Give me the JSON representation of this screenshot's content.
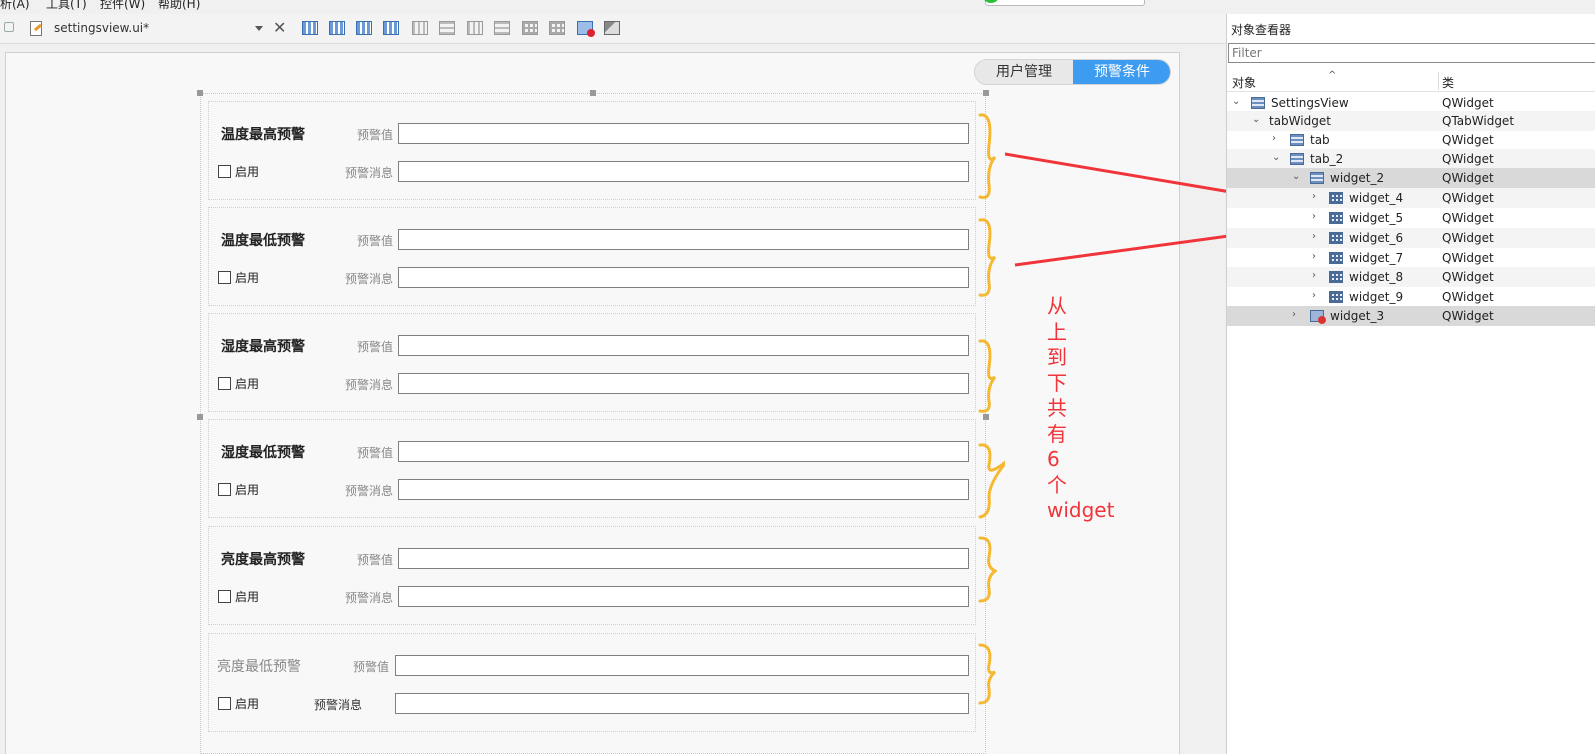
{
  "menubar": {
    "items": [
      "析(A)",
      "工具(T)",
      "控件(W)",
      "帮助(H)"
    ]
  },
  "toolbar": {
    "filename": "settingsview.ui*",
    "close_glyph": "✕"
  },
  "tabs": [
    {
      "label": "用户管理",
      "active": false
    },
    {
      "label": "预警条件",
      "active": true
    }
  ],
  "accent_color": "#3d9cf0",
  "groups": [
    {
      "title": "温度最高预警",
      "value_label": "预警值",
      "message_label": "预警消息",
      "enable_label": "启用"
    },
    {
      "title": "温度最低预警",
      "value_label": "预警值",
      "message_label": "预警消息",
      "enable_label": "启用"
    },
    {
      "title": "湿度最高预警",
      "value_label": "预警值",
      "message_label": "预警消息",
      "enable_label": "启用"
    },
    {
      "title": "湿度最低预警",
      "value_label": "预警值",
      "message_label": "预警消息",
      "enable_label": "启用"
    },
    {
      "title": "亮度最高预警",
      "value_label": "预警值",
      "message_label": "预警消息",
      "enable_label": "启用"
    },
    {
      "title": "亮度最低预警",
      "value_label": "预警值",
      "message_label": "预警消息",
      "enable_label": "启用"
    }
  ],
  "annotation": {
    "chars": [
      "从",
      "上",
      "到",
      "下",
      "共",
      "有",
      "6",
      "个",
      "widget"
    ],
    "color": "#f0343a"
  },
  "inspector": {
    "title": "对象查看器",
    "filter_placeholder": "Filter",
    "col_object": "对象",
    "col_class": "类",
    "rows": [
      {
        "name": "SettingsView",
        "cls": "QWidget",
        "icon": "widget-icon"
      },
      {
        "name": "tabWidget",
        "cls": "QTabWidget",
        "icon": ""
      },
      {
        "name": "tab",
        "cls": "QWidget",
        "icon": "widget-icon"
      },
      {
        "name": "tab_2",
        "cls": "QWidget",
        "icon": "widget-icon"
      },
      {
        "name": "widget_2",
        "cls": "QWidget",
        "icon": "widget-icon"
      },
      {
        "name": "widget_4",
        "cls": "QWidget",
        "icon": "grid-layout-icon"
      },
      {
        "name": "widget_5",
        "cls": "QWidget",
        "icon": "grid-layout-icon"
      },
      {
        "name": "widget_6",
        "cls": "QWidget",
        "icon": "grid-layout-icon"
      },
      {
        "name": "widget_7",
        "cls": "QWidget",
        "icon": "grid-layout-icon"
      },
      {
        "name": "widget_8",
        "cls": "QWidget",
        "icon": "grid-layout-icon"
      },
      {
        "name": "widget_9",
        "cls": "QWidget",
        "icon": "grid-layout-icon"
      },
      {
        "name": "widget_3",
        "cls": "QWidget",
        "icon": "broken-layout-icon"
      }
    ]
  }
}
